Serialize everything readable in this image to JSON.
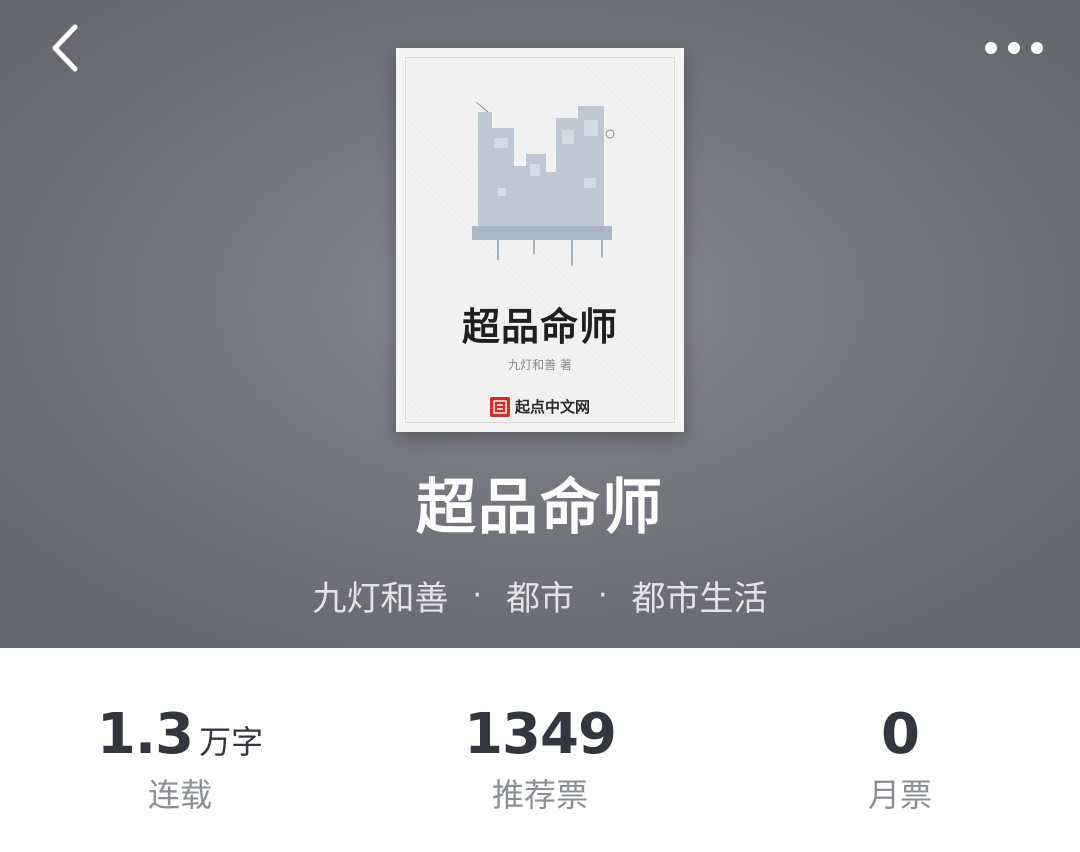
{
  "header": {
    "back_icon": "chevron-left-icon",
    "more_icon": "more-dots-icon"
  },
  "cover": {
    "title": "超品命师",
    "author_line": "九灯和善 著",
    "publisher": "起点中文网",
    "publisher_logo_text": "起点"
  },
  "book": {
    "title": "超品命师",
    "meta": [
      "九灯和善",
      "都市",
      "都市生活"
    ],
    "separator": "·"
  },
  "stats": [
    {
      "value": "1.3",
      "unit": "万字",
      "label": "连载"
    },
    {
      "value": "1349",
      "unit": "",
      "label": "推荐票"
    },
    {
      "value": "0",
      "unit": "",
      "label": "月票"
    }
  ],
  "colors": {
    "header_bg": "#77777f",
    "title_text": "#ffffff",
    "stat_value": "#33373d",
    "stat_label": "#8c8f95",
    "publisher_red": "#c9332b"
  }
}
